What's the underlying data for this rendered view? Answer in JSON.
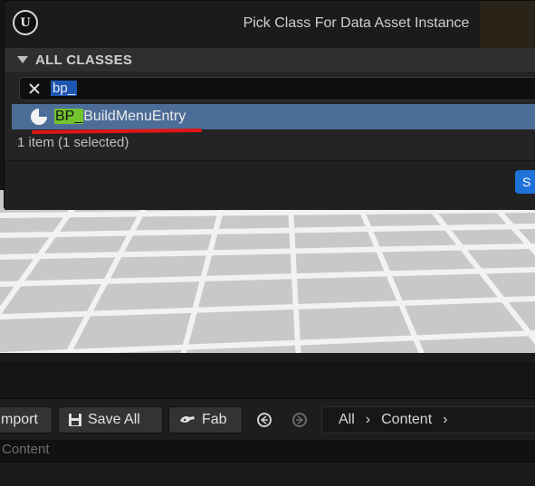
{
  "dialog": {
    "title": "Pick Class For Data Asset Instance",
    "section_title": "ALL CLASSES",
    "search": {
      "value": "bp_"
    },
    "results": [
      {
        "highlight": "BP_",
        "rest": "BuildMenuEntry"
      }
    ],
    "item_count": "1 item (1 selected)",
    "select_button_label": "S"
  },
  "content_browser": {
    "import_label": "mport",
    "save_all_label": "Save All",
    "fab_label": "Fab",
    "path": [
      "All",
      "Content"
    ],
    "search_placeholder": "Content"
  },
  "colors": {
    "selection": "#4d6d99",
    "match_highlight": "#74c32f",
    "annotation_underline": "#e01616",
    "primary_button": "#1f72d8"
  }
}
